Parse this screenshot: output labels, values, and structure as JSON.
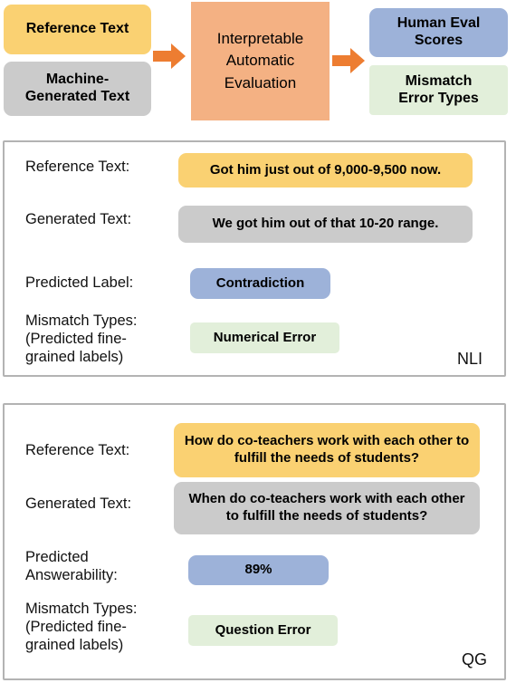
{
  "flow": {
    "inputs": [
      {
        "id": "reference-text",
        "label": "Reference Text",
        "color": "#fad172"
      },
      {
        "id": "machine-generated-text",
        "label": "Machine-\nGenerated Text",
        "color": "#cbcbcb"
      }
    ],
    "process": {
      "id": "evaluation",
      "label": "Interpretable\nAutomatic\nEvaluation",
      "color": "#f4b183"
    },
    "outputs": [
      {
        "id": "human-eval-scores",
        "label": "Human Eval\nScores",
        "color": "#9db2d9"
      },
      {
        "id": "mismatch-error-types",
        "label": "Mismatch\nError Types",
        "color": "#e2efda"
      }
    ],
    "arrow_color": "#ed7d31"
  },
  "panels": [
    {
      "id": "nli",
      "corner_tag": "NLI",
      "rows": [
        {
          "label": "Reference Text:",
          "value": "Got him just out of 9,000-9,500 now.",
          "color": "#fad172"
        },
        {
          "label": "Generated Text:",
          "value": "We got him out of that 10-20 range.",
          "color": "#cbcbcb"
        },
        {
          "label": "Predicted Label:",
          "value": "Contradiction",
          "color": "#9db2d9"
        },
        {
          "label": "Mismatch Types:\n(Predicted fine-\ngrained labels)",
          "value": "Numerical Error",
          "color": "#e2efda"
        }
      ]
    },
    {
      "id": "qg",
      "corner_tag": "QG",
      "rows": [
        {
          "label": "Reference Text:",
          "value": "How do co-teachers work with each other to fulfill the needs of students?",
          "color": "#fad172"
        },
        {
          "label": "Generated Text:",
          "value": "When do co-teachers work with each other to fulfill the needs of students?",
          "color": "#cbcbcb"
        },
        {
          "label": "Predicted\nAnswerability:",
          "value": "89%",
          "color": "#9db2d9"
        },
        {
          "label": "Mismatch Types:\n(Predicted fine-\ngrained labels)",
          "value": "Question Error",
          "color": "#e2efda"
        }
      ]
    }
  ]
}
